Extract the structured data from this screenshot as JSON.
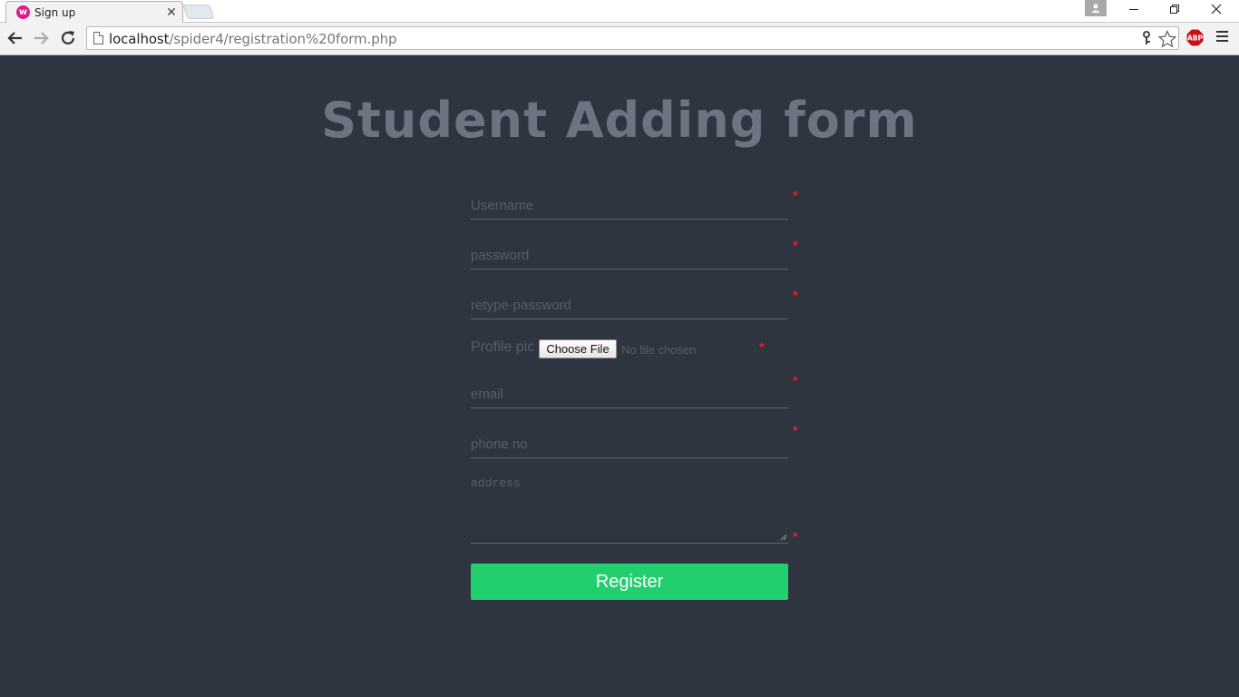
{
  "browser": {
    "tab_title": "Sign up",
    "tab_favicon": "w",
    "url_host": "localhost",
    "url_path": "/spider4/registration%20form.php",
    "icons": [
      "back-arrow-icon",
      "forward-arrow-icon",
      "reload-icon",
      "page-icon",
      "key-icon",
      "star-icon",
      "adblock-icon",
      "menu-icon",
      "profile-icon"
    ],
    "abp_label": "ABP"
  },
  "form": {
    "title": "Student Adding form",
    "username_placeholder": "Username",
    "password_placeholder": "password",
    "retype_placeholder": "retype-password",
    "profile_pic_label": "Profile pic",
    "choose_file_label": "Choose File",
    "file_status": "No file chosen",
    "email_placeholder": "email",
    "phone_placeholder": "phone no",
    "address_placeholder": "address",
    "required_marker": "*",
    "register_label": "Register"
  },
  "colors": {
    "page_background": "#2e3540",
    "title": "#6b7480",
    "required": "#e8202a",
    "register_button": "#22cf6e"
  }
}
